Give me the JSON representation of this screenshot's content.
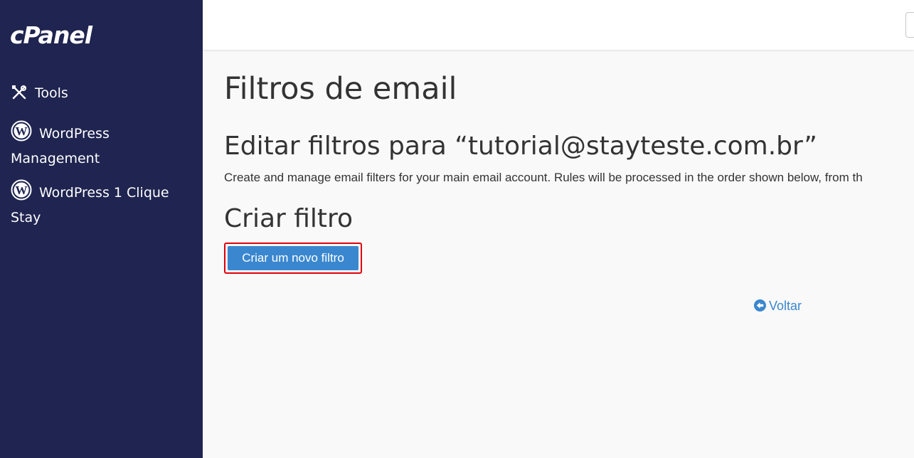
{
  "sidebar": {
    "logo": "cPanel",
    "items": [
      {
        "label": "Tools",
        "icon": "tools-icon"
      },
      {
        "label": "WordPress Management",
        "icon": "wordpress-icon"
      },
      {
        "label": "WordPress 1 Clique Stay",
        "icon": "wordpress-icon"
      }
    ]
  },
  "main": {
    "page_title": "Filtros de email",
    "subtitle": "Editar filtros para “tutorial@stayteste.com.br”",
    "description": "Create and manage email filters for your main email account. Rules will be processed in the order shown below, from th",
    "section_title": "Criar filtro",
    "create_button": "Criar um novo filtro",
    "back_link": "Voltar"
  },
  "colors": {
    "sidebar_bg": "#1f2450",
    "accent": "#3a87cf",
    "highlight_border": "#e0000b"
  }
}
